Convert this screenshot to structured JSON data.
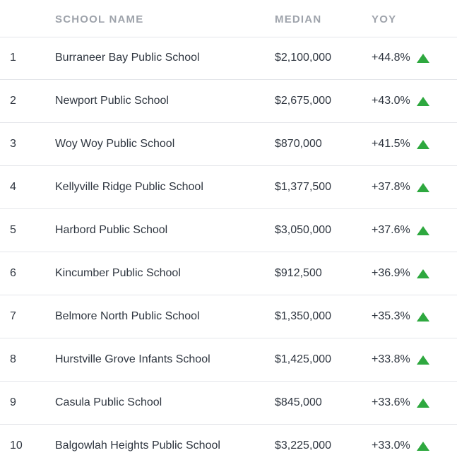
{
  "table": {
    "headers": {
      "name": "SCHOOL NAME",
      "median": "MEDIAN",
      "yoy": "YOY"
    },
    "rows": [
      {
        "rank": "1",
        "name": "Burraneer Bay Public School",
        "median": "$2,100,000",
        "yoy": "+44.8%",
        "trend": "up"
      },
      {
        "rank": "2",
        "name": "Newport Public School",
        "median": "$2,675,000",
        "yoy": "+43.0%",
        "trend": "up"
      },
      {
        "rank": "3",
        "name": "Woy Woy Public School",
        "median": "$870,000",
        "yoy": "+41.5%",
        "trend": "up"
      },
      {
        "rank": "4",
        "name": "Kellyville Ridge Public School",
        "median": "$1,377,500",
        "yoy": "+37.8%",
        "trend": "up"
      },
      {
        "rank": "5",
        "name": "Harbord Public School",
        "median": "$3,050,000",
        "yoy": "+37.6%",
        "trend": "up"
      },
      {
        "rank": "6",
        "name": "Kincumber Public School",
        "median": "$912,500",
        "yoy": "+36.9%",
        "trend": "up"
      },
      {
        "rank": "7",
        "name": "Belmore North Public School",
        "median": "$1,350,000",
        "yoy": "+35.3%",
        "trend": "up"
      },
      {
        "rank": "8",
        "name": "Hurstville Grove Infants School",
        "median": "$1,425,000",
        "yoy": "+33.8%",
        "trend": "up"
      },
      {
        "rank": "9",
        "name": "Casula Public School",
        "median": "$845,000",
        "yoy": "+33.6%",
        "trend": "up"
      },
      {
        "rank": "10",
        "name": "Balgowlah Heights Public School",
        "median": "$3,225,000",
        "yoy": "+33.0%",
        "trend": "up"
      }
    ]
  },
  "colors": {
    "header_text": "#9ea3ab",
    "body_text": "#2f3640",
    "divider": "#e4e6ea",
    "trend_up": "#2ea83f"
  },
  "icons": {
    "trend_up": "triangle-up-icon"
  }
}
